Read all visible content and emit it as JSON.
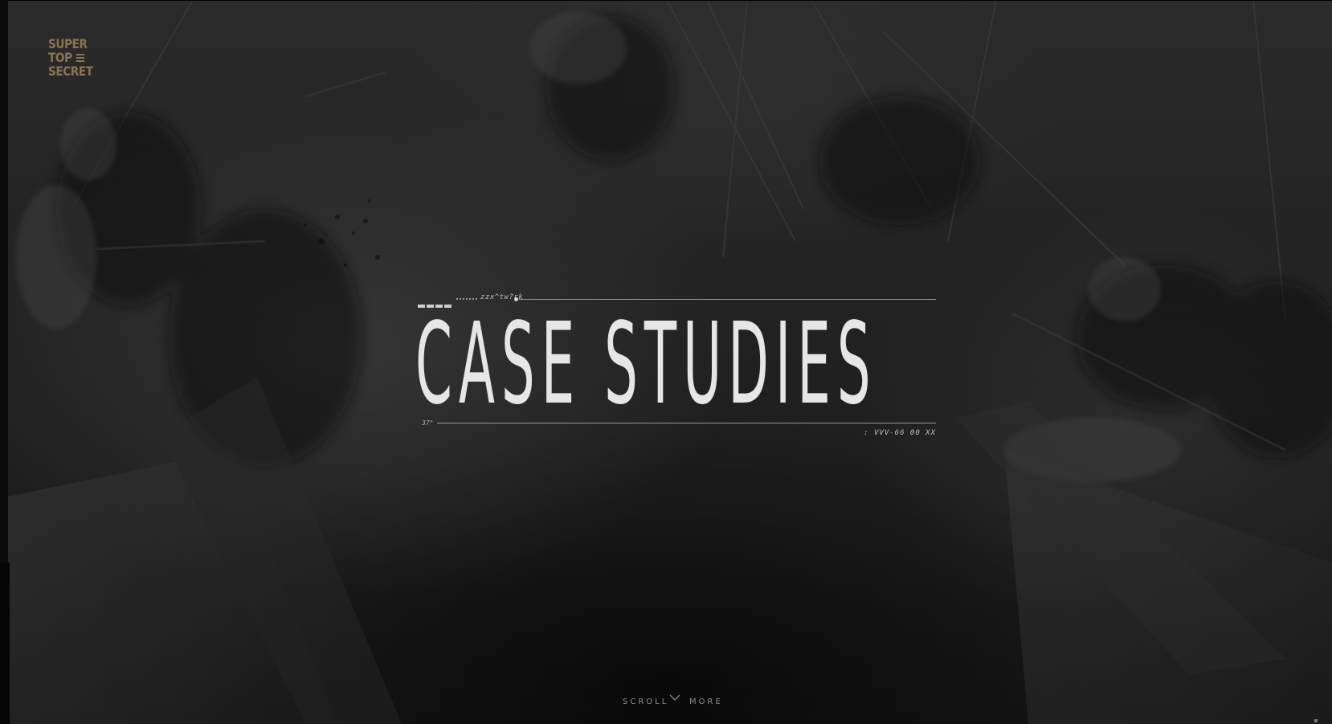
{
  "logo": {
    "line1": "SUPER",
    "line2": "TOP",
    "line3": "SECRET",
    "color": "#8a7552"
  },
  "menu_icon": "hamburger-menu-icon",
  "hero": {
    "code_top": "zzx^tw?rk",
    "title": "CASE STUDIES",
    "code_bottom_left": "37°",
    "code_bottom_right": ": VVV-66 00   XX"
  },
  "scroll": {
    "left_label": "SCROLL",
    "right_label": "MORE",
    "icon": "chevron-down-icon"
  },
  "colors": {
    "background": "#1d1d1d",
    "title": "#e6e6e6",
    "accent": "#8a7552"
  }
}
